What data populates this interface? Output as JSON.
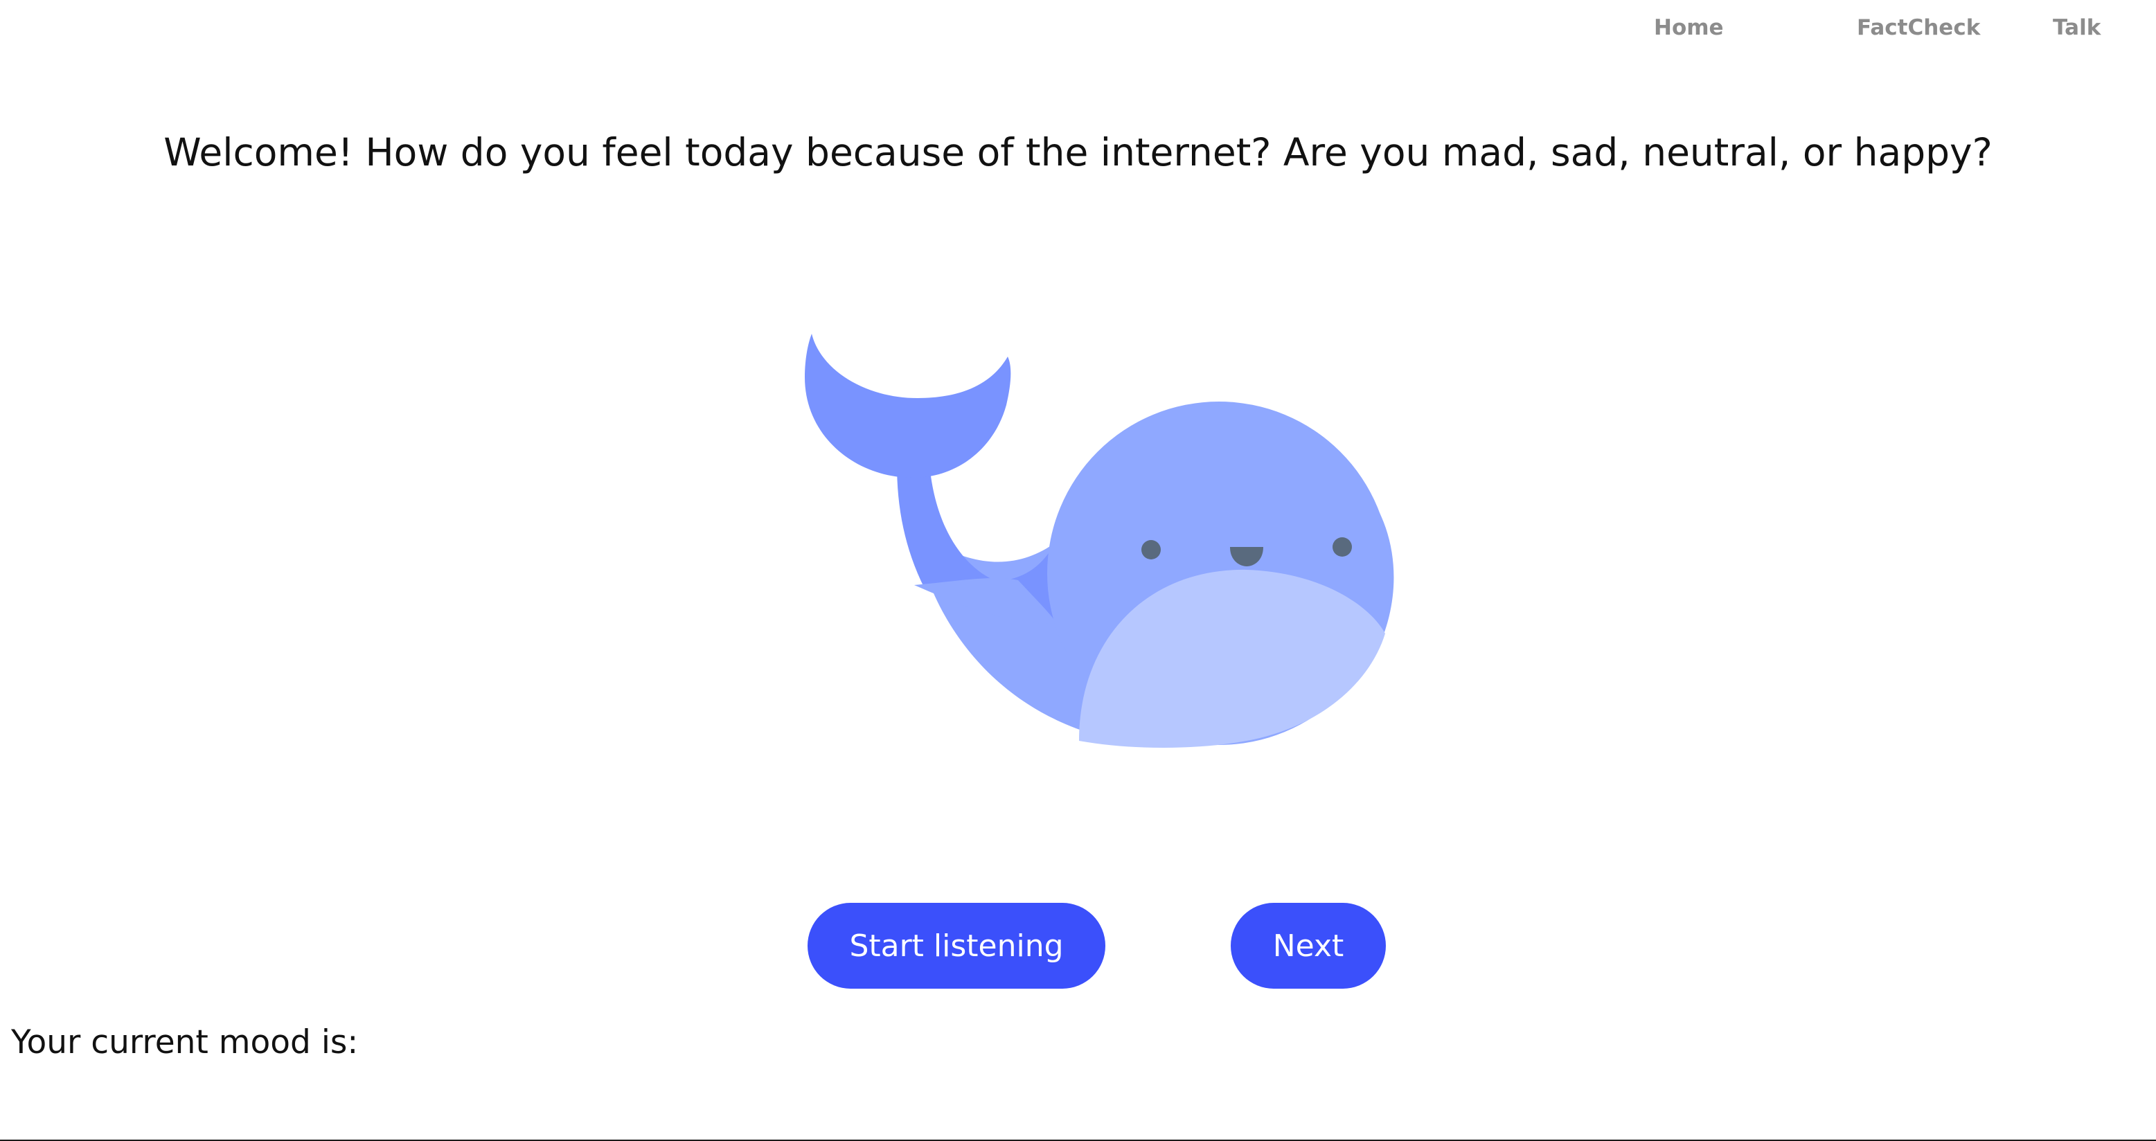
{
  "nav": {
    "items": [
      {
        "label": "Home"
      },
      {
        "label": "FactCheck"
      },
      {
        "label": "Talk"
      }
    ]
  },
  "main": {
    "prompt": "Welcome! How do you feel today because of the internet? Are you mad, sad, neutral, or happy?",
    "illustration_icon": "whale-illustration"
  },
  "actions": {
    "start_label": "Start listening",
    "next_label": "Next"
  },
  "status": {
    "mood_label": "Your current mood is:"
  },
  "colors": {
    "accent": "#3b50fb",
    "nav_text": "#8c8c8c",
    "whale_dark": "#7993ff",
    "whale_mid": "#8fa8ff",
    "whale_light": "#b6c7ff",
    "whale_face": "#596a7e"
  }
}
